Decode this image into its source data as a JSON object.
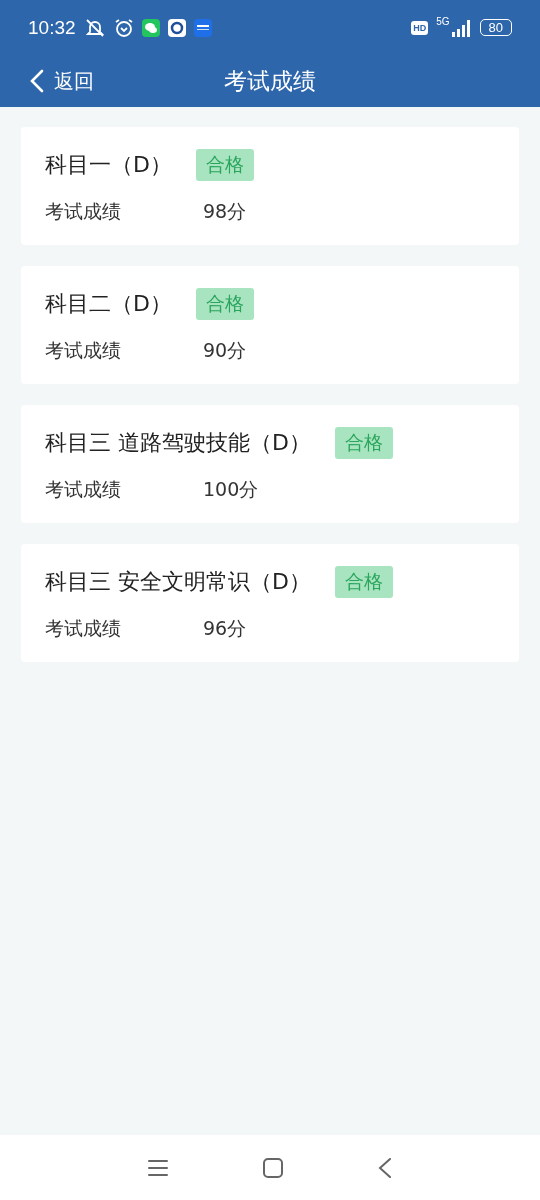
{
  "status_bar": {
    "time": "10:32",
    "hd": "HD",
    "network": "5G",
    "battery": "80"
  },
  "header": {
    "back": "返回",
    "title": "考试成绩"
  },
  "results": [
    {
      "subject": "科目一（D）",
      "status": "合格",
      "label": "考试成绩",
      "score": "98分"
    },
    {
      "subject": "科目二（D）",
      "status": "合格",
      "label": "考试成绩",
      "score": "90分"
    },
    {
      "subject": "科目三 道路驾驶技能（D）",
      "status": "合格",
      "label": "考试成绩",
      "score": "100分"
    },
    {
      "subject": "科目三 安全文明常识（D）",
      "status": "合格",
      "label": "考试成绩",
      "score": "96分"
    }
  ]
}
